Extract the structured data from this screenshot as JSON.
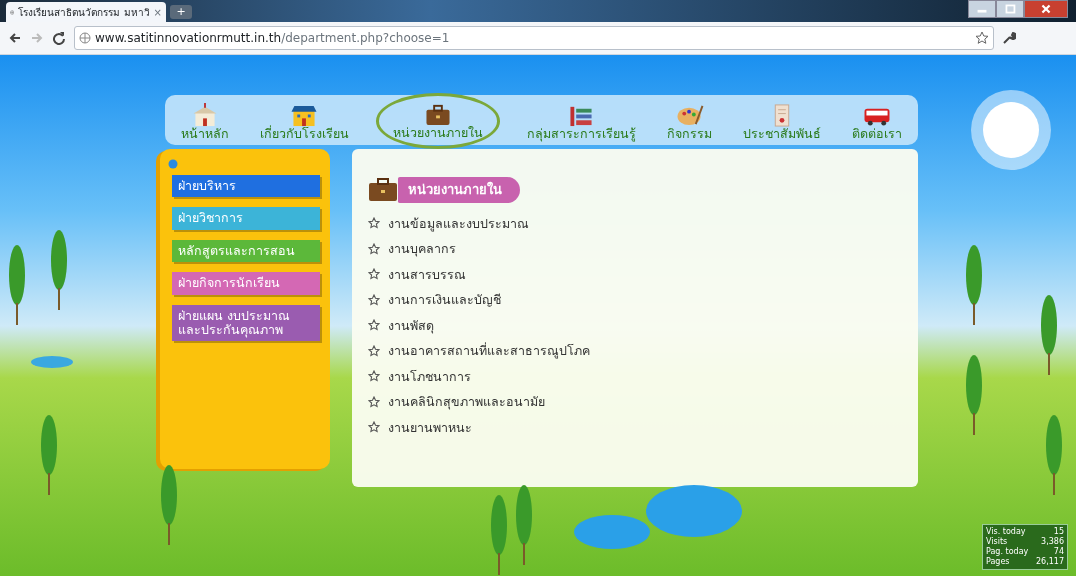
{
  "browser": {
    "tab_title": "โรงเรียนสาธิตนวัตกรรม มหาวิ",
    "tab_close": "×",
    "new_tab": "+",
    "url_host": "www.satitinnovationrmutt.in.th",
    "url_path": "/department.php?choose=1"
  },
  "nav": [
    {
      "label": "หน้าหลัก",
      "selected": false
    },
    {
      "label": "เกี่ยวกับโรงเรียน",
      "selected": false
    },
    {
      "label": "หน่วยงานภายใน",
      "selected": true
    },
    {
      "label": "กลุ่มสาระการเรียนรู้",
      "selected": false
    },
    {
      "label": "กิจกรรม",
      "selected": false
    },
    {
      "label": "ประชาสัมพันธ์",
      "selected": false
    },
    {
      "label": "ติดต่อเรา",
      "selected": false
    }
  ],
  "sidebar": {
    "items": [
      {
        "label": "ฝ่ายบริหาร",
        "color": "#1f6fe0"
      },
      {
        "label": "ฝ่ายวิชาการ",
        "color": "#3cb4d8"
      },
      {
        "label": "หลักสูตรและการสอน",
        "color": "#5cb83a"
      },
      {
        "label": "ฝ่ายกิจการนักเรียน",
        "color": "#d468b4"
      },
      {
        "label": "ฝ่ายแผน งบประมาณ และประกันคุณภาพ",
        "color": "#9a5cb0"
      }
    ]
  },
  "content": {
    "heading": "หน่วยงานภายใน",
    "items": [
      "งานข้อมูลและงบประมาณ",
      "งานบุคลากร",
      "งานสารบรรณ",
      "งานการเงินและบัญชี",
      "งานพัสดุ",
      "งานอาคารสถานที่และสาธารณูปโภค",
      "งานโภชนาการ",
      "งานคลินิกสุขภาพและอนามัย",
      "งานยานพาหนะ"
    ]
  },
  "stats": [
    {
      "label": "Vis. today",
      "value": "15"
    },
    {
      "label": "Visits",
      "value": "3,386"
    },
    {
      "label": "Pag. today",
      "value": "74"
    },
    {
      "label": "Pages",
      "value": "26,117"
    }
  ]
}
